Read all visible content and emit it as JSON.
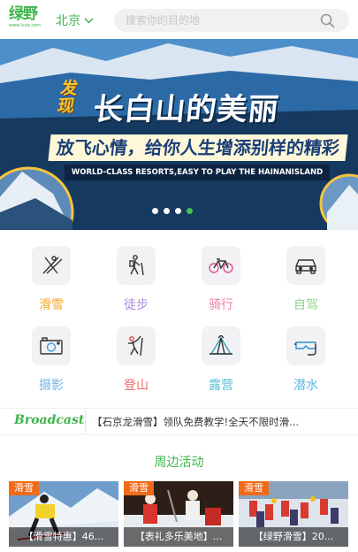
{
  "header": {
    "logo_text": "绿野",
    "logo_url": "www.lvye.com",
    "city": "北京",
    "search_placeholder": "搜索你的目的地"
  },
  "banner": {
    "tag": "发现",
    "title": "长白山的美丽",
    "subtitle": "放飞心情，给你人生增添别样的精彩",
    "english": "WORLD-CLASS RESORTS,EASY TO PLAY THE HAINANISLAND",
    "slides": 4,
    "active_slide": 4
  },
  "categories": [
    {
      "label": "滑雪",
      "icon": "ski-icon",
      "color": "#f5a623"
    },
    {
      "label": "徒步",
      "icon": "hiking-icon",
      "color": "#a98fe0"
    },
    {
      "label": "骑行",
      "icon": "bicycle-icon",
      "color": "#ee7fa6"
    },
    {
      "label": "自驾",
      "icon": "car-icon",
      "color": "#8fd48a"
    },
    {
      "label": "摄影",
      "icon": "camera-icon",
      "color": "#6fb6ea"
    },
    {
      "label": "登山",
      "icon": "climbing-icon",
      "color": "#f06b6b"
    },
    {
      "label": "露营",
      "icon": "tent-icon",
      "color": "#58bfd7"
    },
    {
      "label": "潜水",
      "icon": "diving-mask-icon",
      "color": "#5cb8e0"
    }
  ],
  "broadcast": {
    "logo": "Broadcast",
    "text": "【石京龙滑雪】领队免费教学!全天不限时滑..."
  },
  "nearby": {
    "title": "周边活动",
    "items": [
      {
        "tag": "滑雪",
        "caption": "【滑雪特惠】46..."
      },
      {
        "tag": "滑雪",
        "caption": "【表礼多乐美地】..."
      },
      {
        "tag": "滑雪",
        "caption": "【绿野滑雪】20..."
      }
    ]
  },
  "colors": {
    "brand": "#3bb54a",
    "tag": "#ef6b19"
  }
}
